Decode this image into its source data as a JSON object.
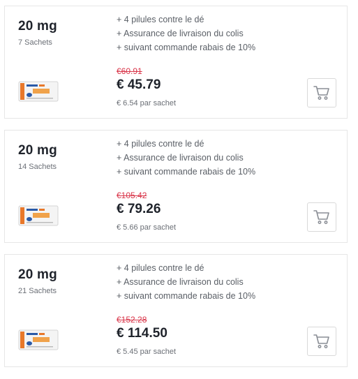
{
  "products": [
    {
      "dose": "20 mg",
      "quantity": "7 Sachets",
      "features": [
        "+ 4 pilules contre le dé",
        "+ Assurance de livraison du colis",
        "+ suivant commande rabais de 10%"
      ],
      "old_price": "€60.91",
      "price": "€ 45.79",
      "per_unit": "€ 6.54 par sachet",
      "thumbnail_icon": "product-package-icon",
      "cart_icon": "cart-icon"
    },
    {
      "dose": "20 mg",
      "quantity": "14 Sachets",
      "features": [
        "+ 4 pilules contre le dé",
        "+ Assurance de livraison du colis",
        "+ suivant commande rabais de 10%"
      ],
      "old_price": "€105.42",
      "price": "€ 79.26",
      "per_unit": "€ 5.66 par sachet",
      "thumbnail_icon": "product-package-icon",
      "cart_icon": "cart-icon"
    },
    {
      "dose": "20 mg",
      "quantity": "21 Sachets",
      "features": [
        "+ 4 pilules contre le dé",
        "+ Assurance de livraison du colis",
        "+ suivant commande rabais de 10%"
      ],
      "old_price": "€152.28",
      "price": "€ 114.50",
      "per_unit": "€ 5.45 par sachet",
      "thumbnail_icon": "product-package-icon",
      "cart_icon": "cart-icon"
    }
  ],
  "colors": {
    "old_price": "#d9364a",
    "text_dark": "#1f232b",
    "text_muted": "#6b6f76",
    "border": "#e6e6e6",
    "package_orange": "#e8782a",
    "package_blue": "#2a5aa8"
  }
}
